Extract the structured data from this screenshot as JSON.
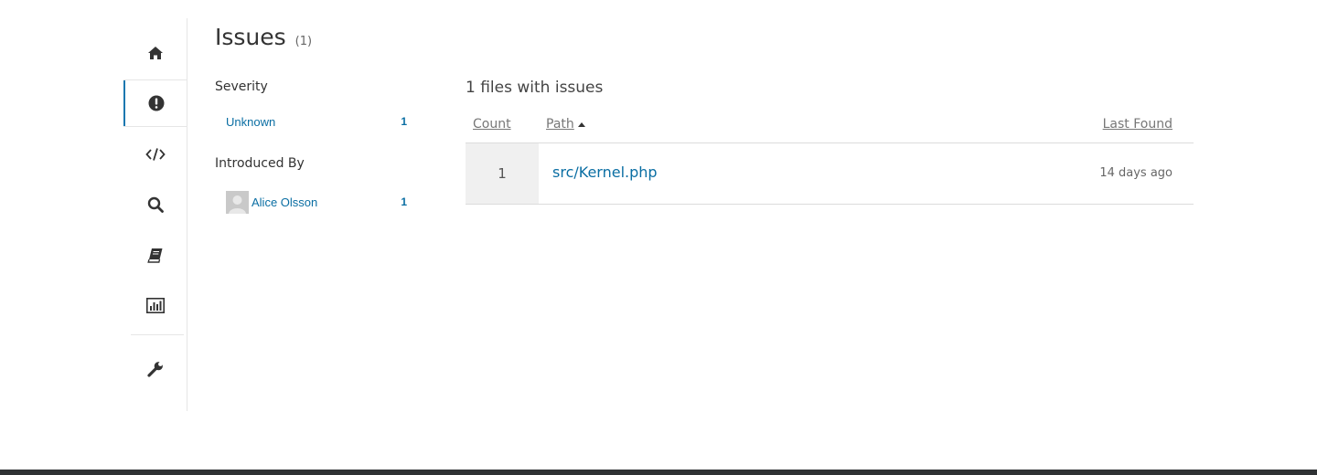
{
  "sidebar": {
    "items": [
      {
        "icon": "home-icon",
        "active": false
      },
      {
        "icon": "exclamation-icon",
        "active": true
      },
      {
        "icon": "code-icon",
        "active": false
      },
      {
        "icon": "search-icon",
        "active": false
      },
      {
        "icon": "book-icon",
        "active": false
      },
      {
        "icon": "bar-chart-icon",
        "active": false
      },
      {
        "icon": "wrench-icon",
        "active": false
      }
    ]
  },
  "page": {
    "title": "Issues",
    "count": "(1)"
  },
  "filters": {
    "severity": {
      "heading": "Severity",
      "items": [
        {
          "label": "Unknown",
          "count": "1"
        }
      ]
    },
    "introduced_by": {
      "heading": "Introduced By",
      "items": [
        {
          "label": "Alice Olsson",
          "count": "1"
        }
      ]
    }
  },
  "results": {
    "heading": "1 files with issues",
    "columns": {
      "count": "Count",
      "path": "Path",
      "last_found": "Last Found"
    },
    "sort": {
      "column": "path",
      "direction": "ascending"
    },
    "rows": [
      {
        "count": "1",
        "path": "src/Kernel.php",
        "last_found": "14 days ago"
      }
    ]
  },
  "colors": {
    "accent": "#1a78b0",
    "link": "#0a6ea3",
    "footer": "#2f3234"
  }
}
